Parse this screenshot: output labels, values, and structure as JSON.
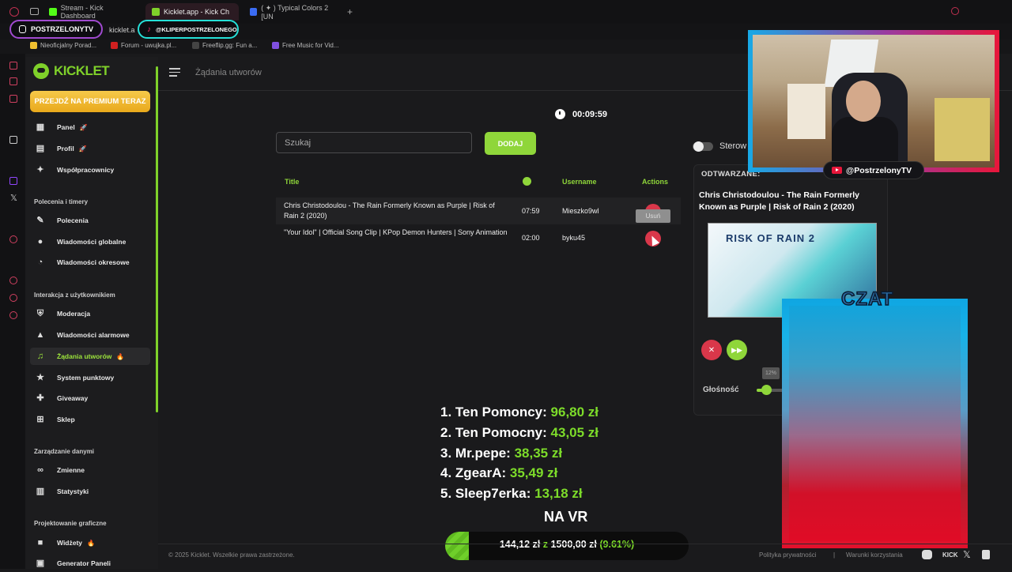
{
  "browser": {
    "tabs": [
      {
        "label": "Stream - Kick Dashboard",
        "color": "#53fc18"
      },
      {
        "label": "Kicklet.app - Kick Ch",
        "color": "#7fd12a"
      },
      {
        "label": "( ✦ ) Typical Colors 2 [UN",
        "color": "#3b6cf4"
      }
    ],
    "new_tab": "+",
    "address_fragment": "kicklet.a",
    "pills": {
      "instagram": "POSTRZELONYTV",
      "tiktok": "@KLIPERPOSTRZELONEGO"
    },
    "bookmarks": [
      "Nieoficjalny Porad...",
      "Forum - uwujka.pl...",
      "Freeflip.gg: Fun a...",
      "Free Music for Vid..."
    ]
  },
  "sidebar": {
    "logo": "KICKLET",
    "premium": "PRZEJDŹ NA PREMIUM TERAZ",
    "items_top": [
      {
        "label": "Panel",
        "badge": "🚀",
        "icon": "grid-icon"
      },
      {
        "label": "Profil",
        "badge": "🚀",
        "icon": "profile-icon"
      },
      {
        "label": "Współpracownicy",
        "badge": "",
        "icon": "collaborators-icon"
      }
    ],
    "sections": {
      "commands": "Polecenia i timery",
      "interaction": "Interakcja z użytkownikiem",
      "data": "Zarządzanie danymi",
      "design": "Projektowanie graficzne"
    },
    "items_commands": [
      {
        "label": "Polecenia",
        "icon": "pen-icon"
      },
      {
        "label": "Wiadomości globalne",
        "icon": "globe-icon"
      },
      {
        "label": "Wiadomości okresowe",
        "icon": "clock-icon"
      }
    ],
    "items_interaction": [
      {
        "label": "Moderacja",
        "icon": "shield-icon"
      },
      {
        "label": "Wiadomości alarmowe",
        "icon": "warning-icon"
      },
      {
        "label": "Żądania utworów",
        "badge": "🔥",
        "icon": "music-icon"
      },
      {
        "label": "System punktowy",
        "icon": "star-icon"
      },
      {
        "label": "Giveaway",
        "icon": "gift-icon"
      },
      {
        "label": "Sklep",
        "icon": "cart-icon"
      }
    ],
    "items_data": [
      {
        "label": "Zmienne",
        "icon": "link-icon"
      },
      {
        "label": "Statystyki",
        "icon": "chart-icon"
      }
    ],
    "items_design": [
      {
        "label": "Widżety",
        "badge": "🔥",
        "icon": "video-icon"
      },
      {
        "label": "Generator Paneli",
        "icon": "panel-icon"
      }
    ]
  },
  "header": {
    "title": "Żądania utworów"
  },
  "timer": "00:09:59",
  "search": {
    "placeholder": "Szukaj"
  },
  "add_button": "DODAJ",
  "toggle_label": "Sterow",
  "table": {
    "headers": {
      "title": "Title",
      "username": "Username",
      "actions": "Actions"
    },
    "rows": [
      {
        "title": "Chris Christodoulou - The Rain Formerly Known as Purple | Risk of Rain 2 (2020)",
        "duration": "07:59",
        "username": "Mieszko9wl"
      },
      {
        "title": "\"Your Idol\" | Official Song Clip | KPop Demon Hunters | Sony Animation",
        "duration": "02:00",
        "username": "byku45"
      }
    ],
    "delete_tooltip": "Usuń"
  },
  "now_playing": {
    "label": "ODTWARZANE:",
    "title": "Chris Christodoulou - The Rain Formerly Known as Purple | Risk of Rain 2 (2020)",
    "thumbnail_text": "RISK OF RAIN 2",
    "volume_label": "Głośność",
    "volume_tip": "12%",
    "volume_level": 0.3
  },
  "overlay": {
    "youtube": "@PostrzelonyTV",
    "chat_title": "CZAT",
    "leaderboard": [
      {
        "rank": "1.",
        "name": "Ten Pomoncy:",
        "amount": "96,80 zł"
      },
      {
        "rank": "2.",
        "name": "Ten Pomocny:",
        "amount": "43,05 zł"
      },
      {
        "rank": "3.",
        "name": "Mr.pepe:",
        "amount": "38,35 zł"
      },
      {
        "rank": "4.",
        "name": "ZgearA:",
        "amount": "35,49 zł"
      },
      {
        "rank": "5.",
        "name": "Sleep7erka:",
        "amount": "13,18 zł"
      }
    ],
    "goal_label": "NA VR",
    "goal_current": "144,12 zł",
    "goal_sep": "z",
    "goal_target": "1500,00 zł",
    "goal_percent": "(9.61%)",
    "goal_fraction": 0.0961
  },
  "footer": {
    "copyright": "© 2025 Kicklet. Wszelkie prawa zastrzeżone.",
    "privacy": "Polityka prywatności",
    "separator": "|",
    "terms": "Warunki korzystania",
    "kick": "KICK"
  }
}
